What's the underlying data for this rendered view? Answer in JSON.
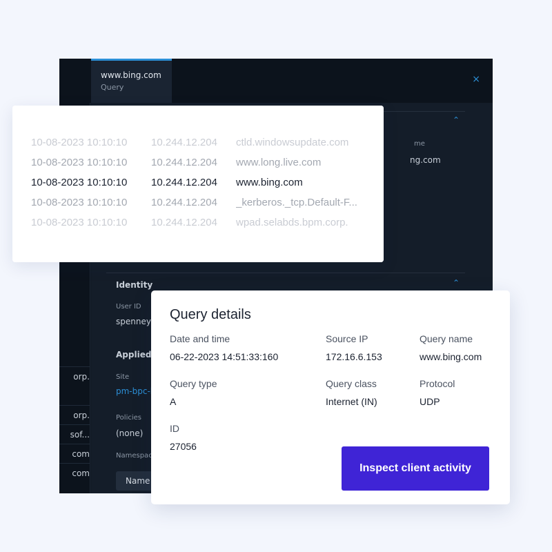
{
  "dark_window": {
    "tab": {
      "title": "www.bing.com",
      "subtitle": "Query"
    },
    "close_glyph": "×",
    "left_items": [
      "orp.",
      "orp.",
      "sof...",
      "com",
      "com"
    ],
    "peek_values": {
      "header_fragment": "me",
      "domain_fragment": "ng.com"
    },
    "identity": {
      "heading": "Identity",
      "user_id_label": "User ID",
      "user_id_value": "spenneyh"
    },
    "applied": {
      "heading": "Applied c",
      "site_label": "Site",
      "site_value": "pm-bpc-l",
      "policies_label": "Policies",
      "policies_value": "(none)",
      "namespace_label": "Namespac",
      "name_button": "Name"
    }
  },
  "log": {
    "rows": [
      {
        "date": "10-08-2023 10:10:10",
        "ip": "10.244.12.204",
        "domain": "ctld.windowsupdate.com",
        "color": "#c9ccd3"
      },
      {
        "date": "10-08-2023 10:10:10",
        "ip": "10.244.12.204",
        "domain": "www.long.live.com",
        "color": "#a3a8b1"
      },
      {
        "date": "10-08-2023 10:10:10",
        "ip": "10.244.12.204",
        "domain": "www.bing.com",
        "color": "#1b2230"
      },
      {
        "date": "10-08-2023 10:10:10",
        "ip": "10.244.12.204",
        "domain": "_kerberos._tcp.Default-F...",
        "color": "#a3a8b1"
      },
      {
        "date": "10-08-2023 10:10:10",
        "ip": "10.244.12.204",
        "domain": "wpad.selabds.bpm.corp.",
        "color": "#c9ccd3"
      }
    ]
  },
  "details": {
    "title": "Query details",
    "date_label": "Date and time",
    "date_value": "06-22-2023 14:51:33:160",
    "source_ip_label": "Source IP",
    "source_ip_value": "172.16.6.153",
    "query_name_label": "Query name",
    "query_name_value": "www.bing.com",
    "query_type_label": "Query type",
    "query_type_value": "A",
    "query_class_label": "Query class",
    "query_class_value": "Internet (IN)",
    "protocol_label": "Protocol",
    "protocol_value": "UDP",
    "id_label": "ID",
    "id_value": "27056",
    "inspect_button": "Inspect client activity"
  },
  "colors": {
    "page_bg": "#f3f6fd",
    "dark_bg": "#0f1722",
    "accent_blue": "#2c8fd6",
    "button_purple": "#3f24d6"
  }
}
